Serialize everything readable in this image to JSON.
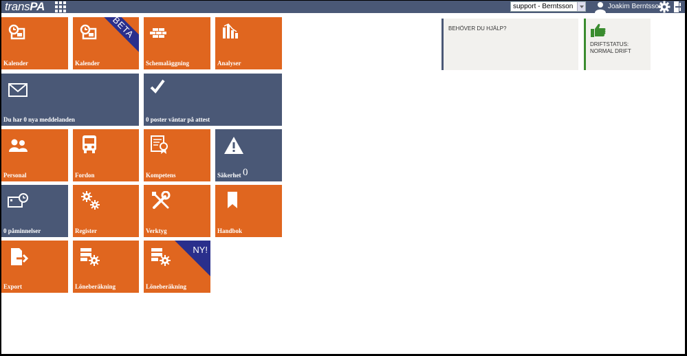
{
  "header": {
    "logo_part1": "trans",
    "logo_part2": "PA",
    "account_select_value": "support - Berntsson",
    "user_name": "Joakim Berntsson"
  },
  "tiles": {
    "kalender": "Kalender",
    "kalender_beta": "Kalender",
    "beta_badge": "BETA",
    "schemalaggning": "Schemaläggning",
    "analyser": "Analyser",
    "meddelanden": "Du har 0 nya meddelanden",
    "attest": "0 poster väntar på attest",
    "personal": "Personal",
    "fordon": "Fordon",
    "kompetens": "Kompetens",
    "sakerhet": "Säkerhet",
    "sakerhet_count": "0",
    "paminnelser": "0 påminnelser",
    "register": "Register",
    "verktyg": "Verktyg",
    "handbok": "Handbok",
    "export": "Export",
    "loneberakning": "Löneberäkning",
    "loneberakning_ny": "Löneberäkning",
    "ny_badge": "NY!"
  },
  "panels": {
    "help_text": "BEHÖVER DU HJÄLP?",
    "status_line1": "DRIFTSTATUS:",
    "status_line2": "NORMAL DRIFT"
  },
  "colors": {
    "orange": "#e0661f",
    "slate": "#4a5876",
    "badge_blue": "#2a2f8c",
    "status_green": "#3a8c2f"
  }
}
